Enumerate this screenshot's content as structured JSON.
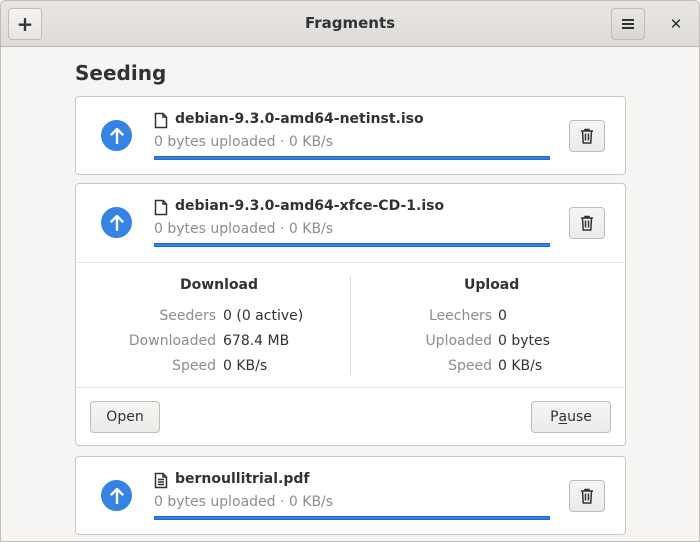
{
  "window": {
    "title": "Fragments",
    "add_button_icon": "plus-icon",
    "menu_button_icon": "hamburger-icon",
    "close_button_icon": "close-icon"
  },
  "section": {
    "title": "Seeding"
  },
  "torrents": [
    {
      "name": "debian-9.3.0-amd64-netinst.iso",
      "status": "0 bytes uploaded · 0 KB/s",
      "progress": 1.0,
      "file_icon": "document-icon",
      "expanded": false
    },
    {
      "name": "debian-9.3.0-amd64-xfce-CD-1.iso",
      "status": "0 bytes uploaded · 0 KB/s",
      "progress": 1.0,
      "file_icon": "document-icon",
      "expanded": true,
      "details": {
        "download": {
          "title": "Download",
          "seeders_label": "Seeders",
          "seeders_value": "0 (0 active)",
          "downloaded_label": "Downloaded",
          "downloaded_value": "678.4 MB",
          "speed_label": "Speed",
          "speed_value": "0 KB/s"
        },
        "upload": {
          "title": "Upload",
          "leechers_label": "Leechers",
          "leechers_value": "0",
          "uploaded_label": "Uploaded",
          "uploaded_value": "0 bytes",
          "speed_label": "Speed",
          "speed_value": "0 KB/s"
        },
        "open_label": "Open",
        "pause_label_pre": "P",
        "pause_label_mn": "a",
        "pause_label_post": "use"
      }
    },
    {
      "name": "bernoullitrial.pdf",
      "status": "0 bytes uploaded · 0 KB/s",
      "progress": 1.0,
      "file_icon": "text-document-icon",
      "expanded": false
    }
  ],
  "colors": {
    "accent": "#3584e4",
    "text": "#2e3436",
    "dim_text": "#8b8e8f"
  }
}
